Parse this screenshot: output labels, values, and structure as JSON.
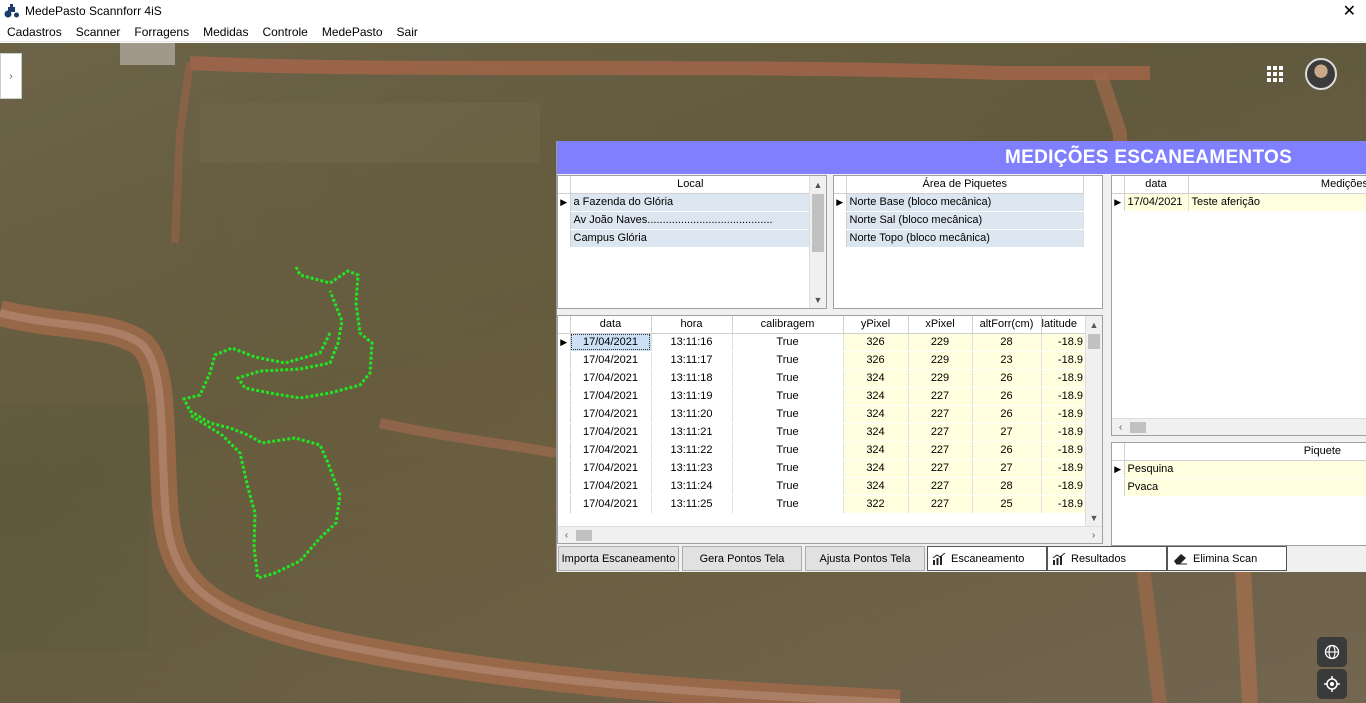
{
  "window": {
    "title": "MedePasto Scannforr 4iS",
    "close": "✕"
  },
  "menu": [
    "Cadastros",
    "Scanner",
    "Forragens",
    "Medidas",
    "Controle",
    "MedePasto",
    "Sair"
  ],
  "panel": {
    "title": "MEDIÇÕES ESCANEAMENTOS",
    "local_grid": {
      "header": "Local",
      "rows": [
        "a Fazenda do Glória",
        "Av João Naves.........................................",
        "Campus Glória"
      ]
    },
    "area_grid": {
      "header": "Área de Piquetes",
      "rows": [
        "Norte Base (bloco mecânica)",
        "Norte Sal (bloco mecânica)",
        "Norte Topo (bloco mecânica)"
      ]
    },
    "medicoes_grid": {
      "headers": [
        "data",
        "Medições C"
      ],
      "rows": [
        [
          "17/04/2021",
          "Teste aferição"
        ]
      ]
    },
    "piquete_grid": {
      "header": "Piquete",
      "rows": [
        "Pesquina",
        "Pvaca"
      ]
    },
    "scan_grid": {
      "headers": [
        "data",
        "hora",
        "calibragem",
        "yPixel",
        "xPixel",
        "altForr(cm)",
        "latitude"
      ],
      "rows": [
        [
          "17/04/2021",
          "13:11:16",
          "True",
          "326",
          "229",
          "28",
          "-18.9"
        ],
        [
          "17/04/2021",
          "13:11:17",
          "True",
          "326",
          "229",
          "23",
          "-18.9"
        ],
        [
          "17/04/2021",
          "13:11:18",
          "True",
          "324",
          "229",
          "26",
          "-18.9"
        ],
        [
          "17/04/2021",
          "13:11:19",
          "True",
          "324",
          "227",
          "26",
          "-18.9"
        ],
        [
          "17/04/2021",
          "13:11:20",
          "True",
          "324",
          "227",
          "26",
          "-18.9"
        ],
        [
          "17/04/2021",
          "13:11:21",
          "True",
          "324",
          "227",
          "27",
          "-18.9"
        ],
        [
          "17/04/2021",
          "13:11:22",
          "True",
          "324",
          "227",
          "26",
          "-18.9"
        ],
        [
          "17/04/2021",
          "13:11:23",
          "True",
          "324",
          "227",
          "27",
          "-18.9"
        ],
        [
          "17/04/2021",
          "13:11:24",
          "True",
          "324",
          "227",
          "28",
          "-18.9"
        ],
        [
          "17/04/2021",
          "13:11:25",
          "True",
          "322",
          "227",
          "25",
          "-18.9"
        ]
      ]
    },
    "buttons": {
      "importa": "Importa Escaneamento",
      "gera": "Gera Pontos Tela",
      "ajusta": "Ajusta Pontos Tela",
      "escaneamento": "Escaneamento",
      "resultados": "Resultados",
      "elimina": "Elimina Scan"
    }
  },
  "icons": {
    "app": "tractor-icon",
    "apps": "apps-grid-icon",
    "avatar": "avatar",
    "globe": "globe-icon",
    "locate": "crosshair-icon"
  },
  "colors": {
    "header": "#8080ff",
    "track": "#22e522"
  }
}
